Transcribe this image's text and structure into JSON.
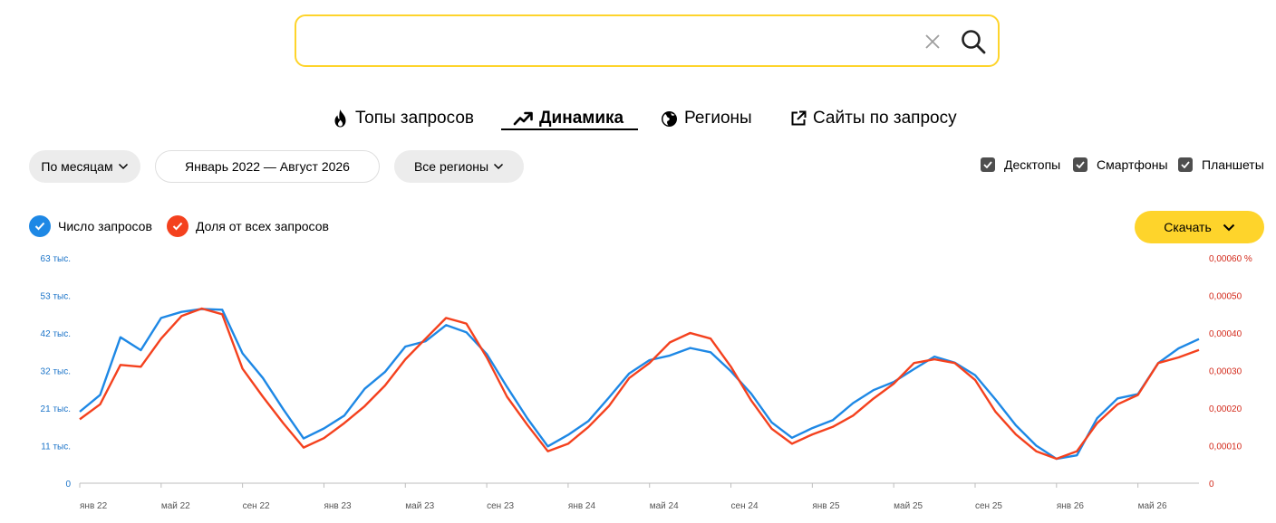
{
  "search": {
    "value": "",
    "placeholder": ""
  },
  "tabs": [
    {
      "label": "Топы запросов",
      "icon": "fire-icon",
      "active": false
    },
    {
      "label": "Динамика",
      "icon": "trend-icon",
      "active": true
    },
    {
      "label": "Регионы",
      "icon": "globe-icon",
      "active": false
    },
    {
      "label": "Сайты по запросу",
      "icon": "external-link-icon",
      "active": false
    }
  ],
  "filters": {
    "period_group": "По месяцам",
    "date_range": "Январь 2022 — Август 2026",
    "region": "Все регионы"
  },
  "devices": [
    {
      "label": "Десктопы",
      "checked": true
    },
    {
      "label": "Смартфоны",
      "checked": true
    },
    {
      "label": "Планшеты",
      "checked": true
    }
  ],
  "legend": {
    "count_label": "Число запросов",
    "share_label": "Доля от всех запросов"
  },
  "download_label": "Скачать",
  "colors": {
    "accent": "#fed42b",
    "count_series": "#1e88e5",
    "share_series": "#f4411e"
  },
  "chart_data": {
    "type": "line",
    "months": [
      "2022-01",
      "2022-02",
      "2022-03",
      "2022-04",
      "2022-05",
      "2022-06",
      "2022-07",
      "2022-08",
      "2022-09",
      "2022-10",
      "2022-11",
      "2022-12",
      "2023-01",
      "2023-02",
      "2023-03",
      "2023-04",
      "2023-05",
      "2023-06",
      "2023-07",
      "2023-08",
      "2023-09",
      "2023-10",
      "2023-11",
      "2023-12",
      "2024-01",
      "2024-02",
      "2024-03",
      "2024-04",
      "2024-05",
      "2024-06",
      "2024-07",
      "2024-08",
      "2024-09",
      "2024-10",
      "2024-11",
      "2024-12",
      "2025-01",
      "2025-02",
      "2025-03",
      "2025-04",
      "2025-05",
      "2025-06",
      "2025-07",
      "2025-08",
      "2025-09",
      "2025-10",
      "2025-11",
      "2025-12",
      "2026-01",
      "2026-02",
      "2026-03",
      "2026-04",
      "2026-05",
      "2026-06",
      "2026-07",
      "2026-08"
    ],
    "x_tick_labels": [
      "янв 22",
      "май 22",
      "сен 22",
      "янв 23",
      "май 23",
      "сен 23",
      "янв 24",
      "май 24",
      "сен 24",
      "янв 25",
      "май 25",
      "сен 25",
      "янв 26",
      "май 26"
    ],
    "y_left": {
      "ticks": [
        "0",
        "11 тыс.",
        "21 тыс.",
        "32 тыс.",
        "42 тыс.",
        "53 тыс.",
        "63 тыс."
      ],
      "ylim": [
        0,
        63000
      ]
    },
    "y_right": {
      "ticks": [
        "0",
        "0,00010",
        "0,00020",
        "0,00030",
        "0,00040",
        "0,00050",
        "0,00060 %"
      ],
      "ylim": [
        0,
        0.0006
      ]
    },
    "series": [
      {
        "name": "Число запросов",
        "axis": "left",
        "values": [
          20000,
          24700,
          40800,
          37200,
          46200,
          47900,
          48700,
          48500,
          36300,
          29400,
          20700,
          12500,
          15300,
          18900,
          26400,
          31100,
          38200,
          39700,
          44200,
          42200,
          36100,
          26900,
          18100,
          10300,
          13500,
          17400,
          23900,
          30700,
          34400,
          35700,
          37800,
          36600,
          31300,
          25000,
          17000,
          12700,
          15400,
          17600,
          22400,
          26000,
          28300,
          31900,
          35400,
          33700,
          30200,
          23400,
          16200,
          10500,
          6800,
          7800,
          18200,
          23700,
          24900,
          33600,
          37700,
          40300
        ]
      },
      {
        "name": "Доля от всех запросов",
        "axis": "right",
        "values": [
          0.00017,
          0.00021,
          0.000315,
          0.00031,
          0.000385,
          0.000445,
          0.000465,
          0.00045,
          0.000305,
          0.00023,
          0.00016,
          9.5e-05,
          0.00012,
          0.00016,
          0.000205,
          0.00026,
          0.00033,
          0.000385,
          0.00044,
          0.000425,
          0.000335,
          0.00023,
          0.000155,
          8.5e-05,
          0.000105,
          0.00015,
          0.000205,
          0.00028,
          0.00032,
          0.000375,
          0.0004,
          0.000385,
          0.00031,
          0.00022,
          0.000145,
          0.000105,
          0.00013,
          0.00015,
          0.00018,
          0.000225,
          0.000265,
          0.00032,
          0.00033,
          0.00032,
          0.000275,
          0.00019,
          0.00013,
          8.5e-05,
          6.5e-05,
          8.5e-05,
          0.00016,
          0.00021,
          0.000235,
          0.00032,
          0.000335,
          0.000355
        ]
      }
    ],
    "grid": false,
    "legend_position": "top-left"
  }
}
